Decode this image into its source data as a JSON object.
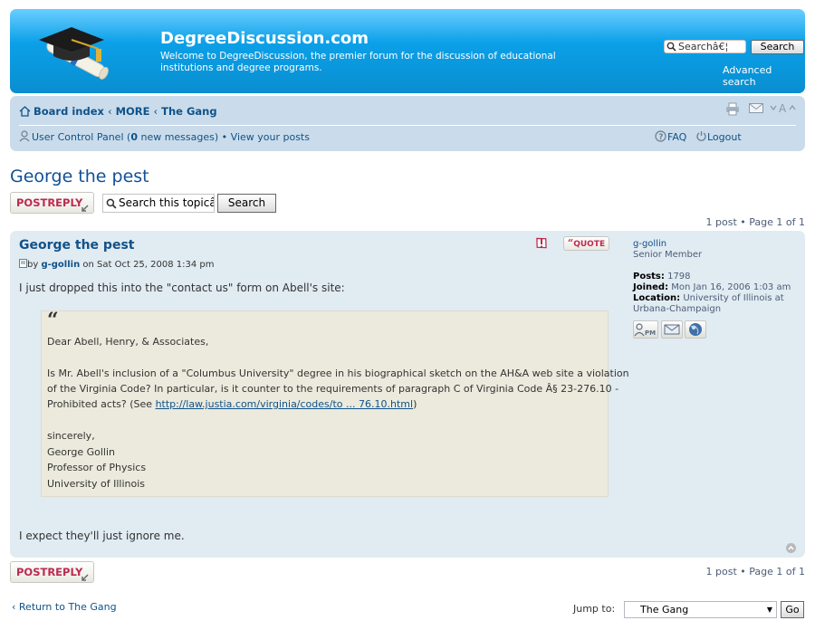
{
  "header": {
    "site_title": "DegreeDiscussion.com",
    "site_description": "Welcome to DegreeDiscussion, the premier forum for the discussion of educational institutions and degree programs.",
    "search_placeholder": "Searchâ€¦",
    "search_button": "Search",
    "advanced_search": "Advanced search",
    "accent_color": "#0BA0E8"
  },
  "nav": {
    "breadcrumb": [
      {
        "label": "Board index"
      },
      {
        "label": "MORE"
      },
      {
        "label": "The Gang"
      }
    ],
    "separator": "‹",
    "ucp_label": "User Control Panel",
    "new_messages_count": "0",
    "new_messages_label": "new messages",
    "view_posts": "View your posts",
    "faq": "FAQ",
    "logout": "Logout",
    "tool_icons": [
      "print-icon",
      "email-icon",
      "font-size-icon"
    ]
  },
  "topic": {
    "title": "George the pest",
    "postreply_label": "POSTREPLY",
    "search_placeholder": "Search this topicâ",
    "search_button": "Search",
    "pagination": {
      "posts_label": "1 post",
      "page_label": "Page",
      "current_page": "1",
      "of_label": "of",
      "total_pages": "1"
    }
  },
  "post": {
    "title": "George the pest",
    "by_label": "by",
    "author": "g-gollin",
    "date_label": "on Sat Oct 25, 2008 1:34 pm",
    "quote_button": "QUOTE",
    "intro": "I just dropped this into the \"contact us\" form on Abell's site:",
    "quote": {
      "greeting": "Dear Abell, Henry, & Associates,",
      "line1": "Is Mr. Abell's inclusion of a \"Columbus University\" degree in his biographical sketch on the AH&A web site a violation",
      "line2": "of the Virginia Code? In particular, is it counter to the requirements of paragraph C of Virginia Code Â§ 23-276.10 -",
      "line3_prefix": "Prohibited acts? (See ",
      "link": "http://law.justia.com/virginia/codes/to ... 76.10.html",
      "line3_suffix": ")",
      "signoff": "sincerely,",
      "sig_name": "George Gollin",
      "sig_title": "Professor of Physics",
      "sig_org": "University of Illinois"
    },
    "closing": "I expect they'll just ignore me."
  },
  "profile": {
    "username": "g-gollin",
    "rank": "Senior Member",
    "posts_label": "Posts:",
    "posts_value": "1798",
    "joined_label": "Joined:",
    "joined_value": "Mon Jan 16, 2006 1:03 am",
    "location_label": "Location:",
    "location_value_1": "University of Illinois at",
    "location_value_2": "Urbana-Champaign",
    "pm_label": "PM"
  },
  "footer": {
    "return_label": "Return to The Gang",
    "jump_label": "Jump to:",
    "jump_selected": "The Gang",
    "go_button": "Go"
  }
}
